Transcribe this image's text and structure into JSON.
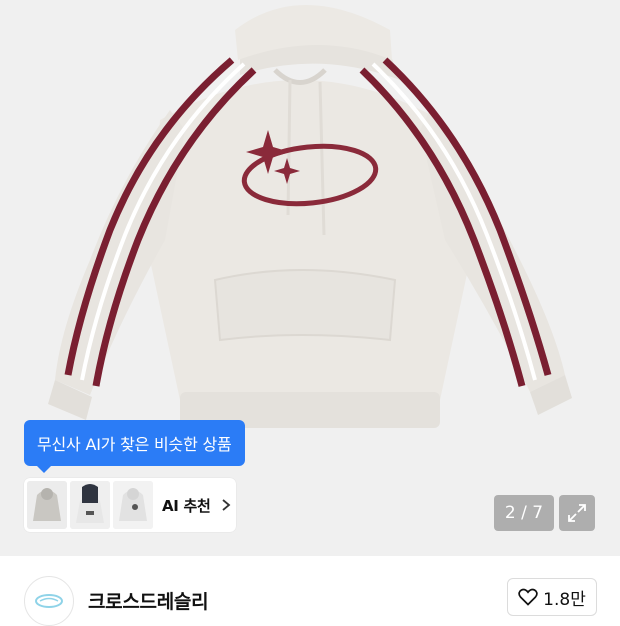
{
  "gallery": {
    "image": "gray hoodie with maroon sleeve stripes and star logo",
    "counter": "2 / 7",
    "current_page": 2,
    "total_pages": 7
  },
  "ai_banner": {
    "tooltip_text": "무신사 AI가 찾은 비슷한 상품",
    "button_label": "AI 추천",
    "thumbnails": [
      "gray hoodie",
      "navy hoodie",
      "gray hoodie with logo"
    ]
  },
  "seller": {
    "brand_name": "크로스드레슬리",
    "like_count": "1.8만"
  },
  "colors": {
    "accent_blue": "#2b7cf6",
    "stripe_maroon": "#7a1f31",
    "hoodie_gray": "#ebe8e3"
  },
  "icons": [
    "heart-icon",
    "expand-icon",
    "chevron-right-icon",
    "brand-logo"
  ]
}
